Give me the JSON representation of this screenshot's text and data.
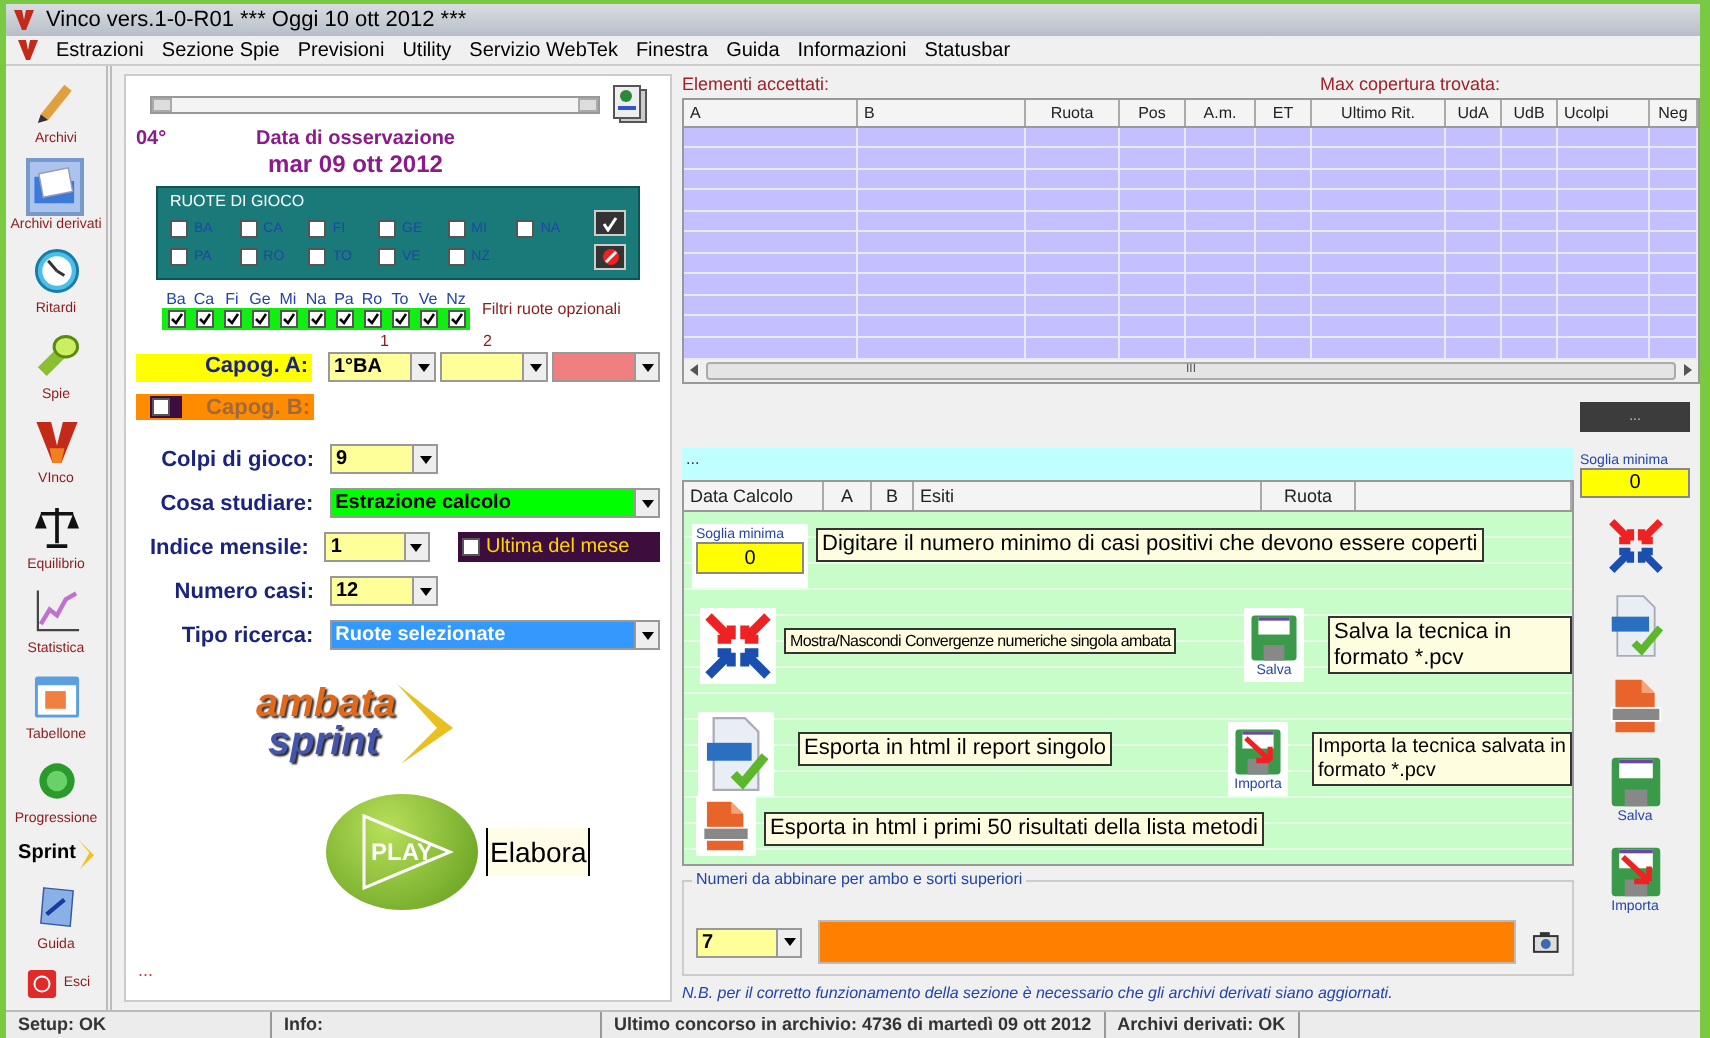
{
  "window": {
    "title": "Vinco vers.1-0-R01  ***  Oggi 10 ott 2012  ***"
  },
  "menu": [
    "Estrazioni",
    "Sezione Spie",
    "Previsioni",
    "Utility",
    "Servizio WebTek",
    "Finestra",
    "Guida",
    "Informazioni",
    "Statusbar"
  ],
  "toolbar": [
    {
      "label": "Archivi",
      "kind": "stacked",
      "selected": false
    },
    {
      "label": "Archivi derivati",
      "kind": "stacked",
      "selected": true
    },
    {
      "label": "Ritardi",
      "kind": "stacked",
      "selected": false
    },
    {
      "label": "Spie",
      "kind": "stacked",
      "selected": false
    },
    {
      "label": "VInco",
      "kind": "stacked",
      "selected": false
    },
    {
      "label": "Equilibrio",
      "kind": "stacked",
      "selected": false
    },
    {
      "label": "Statistica",
      "kind": "stacked",
      "selected": false
    },
    {
      "label": "Tabellone",
      "kind": "stacked",
      "selected": false
    },
    {
      "label": "Progressione",
      "kind": "stacked",
      "selected": false
    },
    {
      "label": "Sprint",
      "kind": "logo",
      "selected": false
    },
    {
      "label": "Guida",
      "kind": "stacked",
      "selected": false
    },
    {
      "label": "Esci",
      "kind": "inline",
      "selected": false
    }
  ],
  "observation": {
    "index": "04°",
    "label": "Data di osservazione",
    "date": "mar 09 ott 2012"
  },
  "ruote_di_gioco": {
    "title": "RUOTE DI GIOCO",
    "wheels": [
      {
        "label": "BA",
        "checked": false
      },
      {
        "label": "CA",
        "checked": false
      },
      {
        "label": "FI",
        "checked": false
      },
      {
        "label": "GE",
        "checked": false
      },
      {
        "label": "MI",
        "checked": false
      },
      {
        "label": "NA",
        "checked": false
      },
      {
        "label": "PA",
        "checked": false
      },
      {
        "label": "RO",
        "checked": false
      },
      {
        "label": "TO",
        "checked": false
      },
      {
        "label": "VE",
        "checked": false
      },
      {
        "label": "NZ",
        "checked": false
      }
    ]
  },
  "filtri": {
    "caption": "Filtri ruote opzionali",
    "wheels": [
      {
        "label": "Ba",
        "checked": true
      },
      {
        "label": "Ca",
        "checked": true
      },
      {
        "label": "Fi",
        "checked": true
      },
      {
        "label": "Ge",
        "checked": true
      },
      {
        "label": "Mi",
        "checked": true
      },
      {
        "label": "Na",
        "checked": true
      },
      {
        "label": "Pa",
        "checked": true
      },
      {
        "label": "Ro",
        "checked": true
      },
      {
        "label": "To",
        "checked": true
      },
      {
        "label": "Ve",
        "checked": true
      },
      {
        "label": "Nz",
        "checked": true
      }
    ]
  },
  "capog_columns": [
    "1",
    "2"
  ],
  "capog_a": {
    "label": "Capog. A:",
    "selects": [
      {
        "value": "1°BA",
        "color": "#ffff99"
      },
      {
        "color": "#ffff99"
      },
      {
        "color": "#f08080"
      }
    ]
  },
  "capog_b": {
    "label": "Capog. B:",
    "checked": false,
    "disabled": true
  },
  "settings": [
    {
      "label": "Colpi di gioco:",
      "value": "9",
      "kind": "short",
      "color": "#ffff99"
    },
    {
      "label": "Cosa studiare:",
      "value": "Estrazione calcolo",
      "kind": "long",
      "color": "#00ff00"
    },
    {
      "label": "Indice mensile:",
      "value": "1",
      "kind": "short",
      "color": "#ffff99",
      "option": {
        "label": "Ultima del mese",
        "checked": false
      }
    },
    {
      "label": "Numero casi:",
      "value": "12",
      "kind": "short",
      "color": "#ffff99"
    },
    {
      "label": "Tipo ricerca:",
      "value": "Ruote selezionate",
      "kind": "long",
      "color": "#3399ff"
    }
  ],
  "logo": {
    "line_1": "ambata",
    "line_2": "sprint"
  },
  "play": {
    "label": "PLAY",
    "caption": "Elabora"
  },
  "footer": "...",
  "results": {
    "label": "Elementi accettati:",
    "max_label": "Max copertura trovata:",
    "columns": [
      "A",
      "B",
      "Ruota",
      "Pos",
      "A.m.",
      "ET",
      "Ultimo Rit.",
      "UdA",
      "UdB",
      "Ucolpi",
      "Neg"
    ],
    "scroll_mark": "III"
  },
  "side": {
    "button": "...",
    "threshold_label": "Soglia minima",
    "threshold": "0",
    "icons": [
      {
        "kind": "converge"
      },
      {
        "kind": "html-check"
      },
      {
        "kind": "html-doc"
      },
      {
        "kind": "save",
        "label": "Salva"
      },
      {
        "kind": "import",
        "label": "Importa"
      }
    ]
  },
  "methods": {
    "header": "...",
    "columns": [
      "Data Calcolo",
      "A",
      "B",
      "Esiti",
      "Ruota"
    ],
    "threshold_label": "Soglia minima",
    "threshold": "0",
    "hints": [
      {
        "kind": "threshold",
        "text": "Digitare il numero minimo di casi positivi che devono essere coperti"
      },
      {
        "kind": "converge",
        "text": "Mostra/Nascondi Convergenze numeriche singola ambata"
      },
      {
        "kind": "save",
        "text": "Salva la tecnica in formato *.pcv",
        "icon_label": "Salva"
      },
      {
        "kind": "html-check",
        "text": "Esporta in html il report singolo"
      },
      {
        "kind": "import",
        "text": "Importa la tecnica salvata in formato *.pcv",
        "icon_label": "Importa"
      },
      {
        "kind": "html-doc",
        "text": "Esporta in html i primi 50 risultati della lista metodi"
      }
    ]
  },
  "pairing": {
    "title": "Numeri da abbinare per ambo e sorti superiori",
    "value": "7"
  },
  "note": "N.B. per il corretto funzionamento della sezione è necessario che gli archivi derivati siano aggiornati.",
  "status_bar": [
    "Setup: OK",
    "Info:",
    "Ultimo concorso in archivio: 4736 di martedì 09 ott 2012",
    "Archivi derivati: OK"
  ]
}
